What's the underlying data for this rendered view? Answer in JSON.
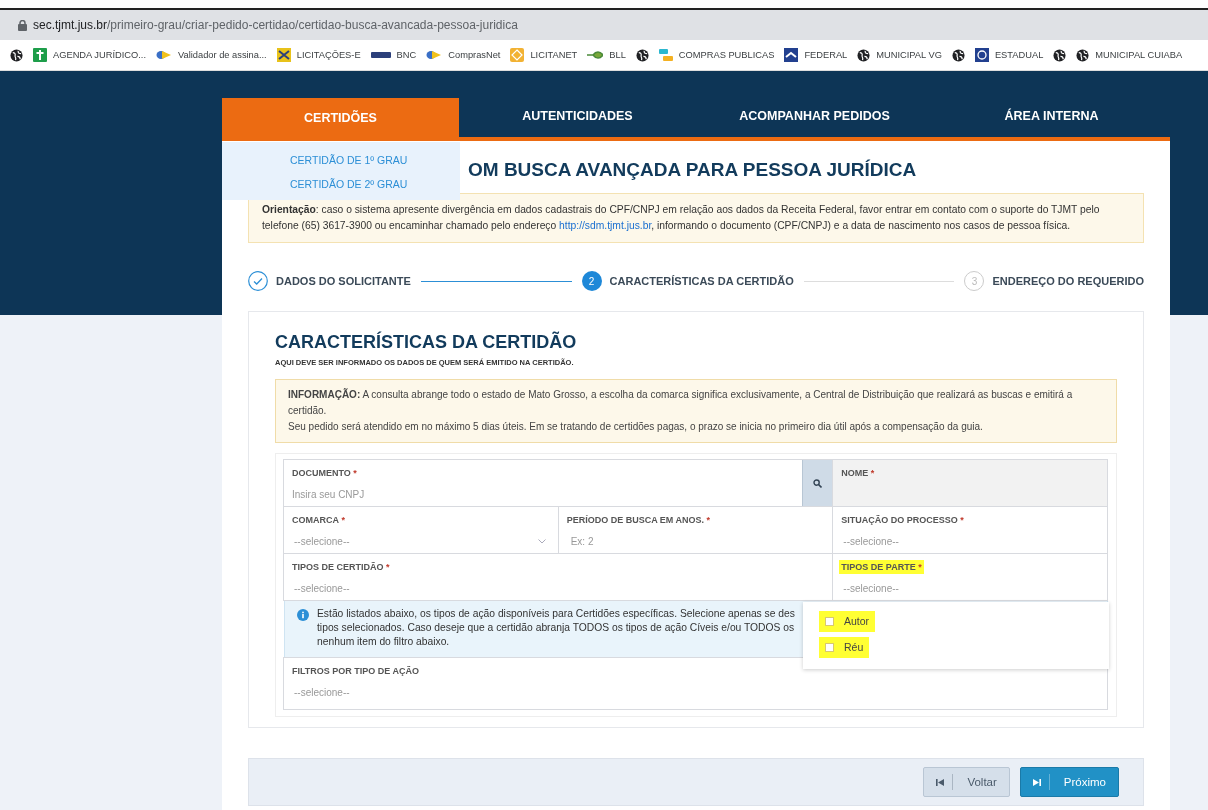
{
  "browser": {
    "url_host": "sec.tjmt.jus.br",
    "url_path": "/primeiro-grau/criar-pedido-certidao/certidao-busca-avancada-pessoa-juridica",
    "bookmarks": [
      {
        "kind": "globe"
      },
      {
        "kind": "green",
        "label": "AGENDA JURÍDICO..."
      },
      {
        "kind": "arrow",
        "label": "Validador de assina..."
      },
      {
        "kind": "yellow",
        "label": "LICITAÇÕES-E"
      },
      {
        "kind": "bnc",
        "label": "BNC"
      },
      {
        "kind": "arrow",
        "label": "ComprasNet"
      },
      {
        "kind": "orange",
        "label": "LICITANET"
      },
      {
        "kind": "leaf",
        "label": "BLL"
      },
      {
        "kind": "globe"
      },
      {
        "kind": "stripes",
        "label": "COMPRAS PUBLICAS"
      },
      {
        "kind": "flag",
        "label": "FEDERAL"
      },
      {
        "kind": "globe",
        "label": "MUNICIPAL VG"
      },
      {
        "kind": "globe"
      },
      {
        "kind": "seal",
        "label": "ESTADUAL"
      },
      {
        "kind": "globe"
      },
      {
        "kind": "globe",
        "label": "MUNICIPAL CUIABA"
      }
    ]
  },
  "nav": {
    "tabs": [
      {
        "label": "CERTIDÕES",
        "selected": true
      },
      {
        "label": "AUTENTICIDADES",
        "selected": false
      },
      {
        "label": "ACOMPANHAR PEDIDOS",
        "selected": false
      },
      {
        "label": "ÁREA INTERNA",
        "selected": false
      }
    ],
    "menu": [
      "CERTIDÃO DE 1º GRAU",
      "CERTIDÃO DE 2º GRAU"
    ]
  },
  "page_title": "OM BUSCA AVANÇADA PARA PESSOA JURÍDICA",
  "orientation": {
    "lead": "Orientação",
    "text": ": caso o sistema apresente divergência em dados cadastrais do CPF/CNPJ em relação aos dados da Receita Federal, favor entrar em contato com o suporte do TJMT pelo telefone (65) 3617-3900 ou encaminhar chamado pelo endereço ",
    "link": "http://sdm.tjmt.jus.br",
    "tail": ", informando o documento (CPF/CNPJ) e a data de nascimento nos casos de pessoa física."
  },
  "steps": [
    {
      "label": "DADOS DO SOLICITANTE",
      "kind": "done"
    },
    {
      "number": "2",
      "label": "CARACTERÍSTICAS DA CERTIDÃO",
      "kind": "current"
    },
    {
      "number": "3",
      "label": "ENDEREÇO DO REQUERIDO",
      "kind": "pending"
    }
  ],
  "section": {
    "title": "CARACTERÍSTICAS DA CERTIDÃO",
    "subtitle": "AQUI DEVE SER INFORMADO OS DADOS DE QUEM SERÁ EMITIDO NA CERTIDÃO.",
    "info": "**INFORMAÇÃO:** A consulta abrange todo o estado de Mato Grosso, a escolha da comarca significa exclusivamente, a Central de Distribuição que realizará as buscas e emitirá a certidão.\nSeu pedido será atendido em no máximo 5 dias úteis. Em se tratando de certidões pagas, o prazo se inicia no primeiro dia útil após a compensação da guia."
  },
  "form_rows": [
    {
      "fields": [
        {
          "label": "DOCUMENTO",
          "required_mark": "*",
          "kind": "search",
          "placeholder": "Insira seu CNPJ",
          "disabled": false,
          "highlighted": false
        },
        {
          "label": "NOME",
          "required_mark": "*",
          "kind": "text",
          "disabled": true,
          "highlighted": false
        }
      ]
    },
    {
      "fields": [
        {
          "label": "COMARCA",
          "required_mark": "*",
          "kind": "select",
          "placeholder": "--selecione--",
          "disabled": false,
          "highlighted": false
        },
        {
          "label": "PERÍODO DE BUSCA EM ANOS.",
          "required_mark": "*",
          "kind": "text",
          "placeholder": "Ex: 2",
          "disabled": false,
          "highlighted": false
        },
        {
          "label": "SITUAÇÃO DO PROCESSO",
          "required_mark": "*",
          "kind": "picker",
          "placeholder": "--selecione--",
          "disabled": false,
          "highlighted": false
        }
      ]
    },
    {
      "fields": [
        {
          "label": "TIPOS DE CERTIDÃO",
          "required_mark": "*",
          "kind": "picker",
          "placeholder": "--selecione--",
          "disabled": false,
          "highlighted": false
        },
        {
          "label": "TIPOS DE PARTE",
          "required_mark": "*",
          "kind": "picker",
          "placeholder": "--selecione--",
          "disabled": false,
          "highlighted": true
        }
      ]
    }
  ],
  "notice_lines": [
    "Estão listados abaixo, os tipos de ação disponíveis para Certidões específicas. Selecione apenas se des",
    "tipos selecionados. Caso deseje que a certidão abranja TODOS os tipos de ação Cíveis e/ou TODOS os",
    "nenhum item do filtro abaixo."
  ],
  "filter": {
    "label": "FILTROS POR TIPO DE AÇÃO",
    "placeholder": "--selecione--"
  },
  "party_options": [
    {
      "label": "Autor",
      "checked": false,
      "highlighted": true
    },
    {
      "label": "Réu",
      "checked": false,
      "highlighted": true
    }
  ],
  "buttons": [
    {
      "label": "Voltar",
      "kind": "back"
    },
    {
      "label": "Próximo",
      "kind": "next"
    }
  ]
}
